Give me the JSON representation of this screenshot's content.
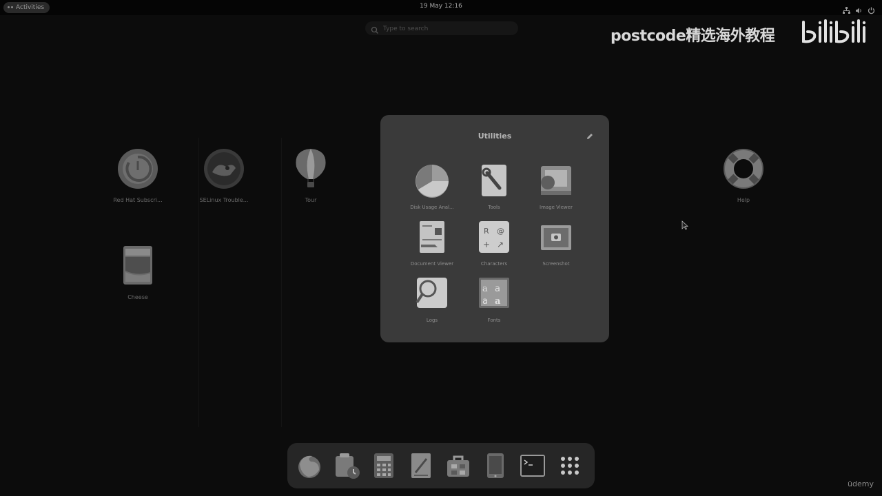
{
  "topbar": {
    "activities_label": "Activities",
    "datetime": "19 May  12:16"
  },
  "search": {
    "placeholder": "Type to search"
  },
  "watermark": {
    "text": "postcode精选海外教程",
    "logo": "bilibili-logo"
  },
  "background_apps": [
    {
      "label": "Red Hat Subscri...",
      "icon": "redhat-subscription-icon"
    },
    {
      "label": "SELinux Trouble...",
      "icon": "selinux-troubleshooter-icon"
    },
    {
      "label": "Tour",
      "icon": "tour-balloon-icon"
    },
    {
      "label": "Help",
      "icon": "help-lifebuoy-icon"
    },
    {
      "label": "Cheese",
      "icon": "cheese-icon"
    }
  ],
  "folder": {
    "title": "Utilities",
    "apps": [
      {
        "label": "Disk Usage Anal...",
        "icon": "disk-usage-icon"
      },
      {
        "label": "Tools",
        "icon": "tools-icon"
      },
      {
        "label": "Image Viewer",
        "icon": "image-viewer-icon"
      },
      {
        "label": "Document Viewer",
        "icon": "document-viewer-icon"
      },
      {
        "label": "Characters",
        "icon": "characters-icon"
      },
      {
        "label": "Screenshot",
        "icon": "screenshot-icon"
      },
      {
        "label": "Logs",
        "icon": "logs-icon"
      },
      {
        "label": "Fonts",
        "icon": "fonts-icon"
      }
    ]
  },
  "dock": [
    {
      "icon": "firefox-icon"
    },
    {
      "icon": "software-update-icon"
    },
    {
      "icon": "calculator-icon"
    },
    {
      "icon": "text-editor-icon"
    },
    {
      "icon": "software-bag-icon"
    },
    {
      "icon": "settings-tablet-icon"
    },
    {
      "icon": "terminal-icon"
    },
    {
      "icon": "app-grid-icon"
    }
  ],
  "corner_brand": "ūdemy"
}
